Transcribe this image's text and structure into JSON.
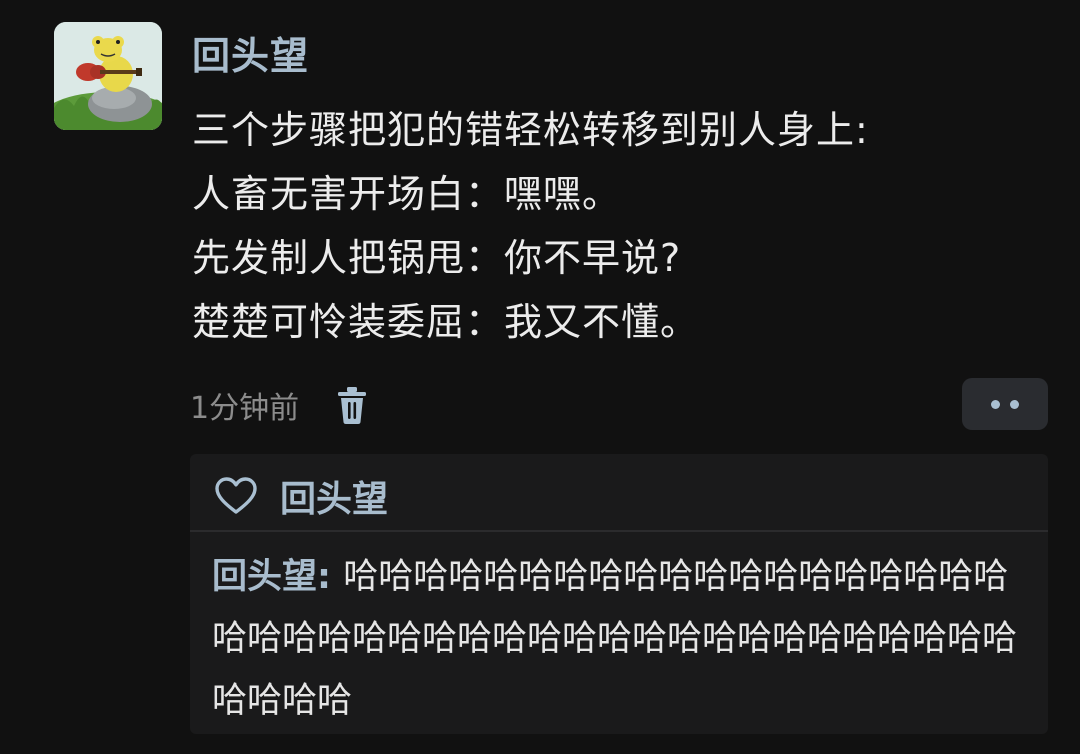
{
  "post": {
    "author": "回头望",
    "lines": [
      "三个步骤把犯的错轻松转移到别人身上:",
      "人畜无害开场白：嘿嘿。",
      "先发制人把锅甩：你不早说?",
      "楚楚可怜装委屈：我又不懂。"
    ],
    "timestamp": "1分钟前",
    "delete_icon": "trash-icon",
    "more_icon": "more-dots-icon"
  },
  "likes": {
    "icon": "heart-icon",
    "names": "回头望"
  },
  "comment": {
    "author": "回头望",
    "separator": ": ",
    "text": "哈哈哈哈哈哈哈哈哈哈哈哈哈哈哈哈哈哈哈哈哈哈哈哈哈哈哈哈哈哈哈哈哈哈哈哈哈哈哈哈哈哈哈哈哈哈"
  },
  "colors": {
    "background": "#111111",
    "name_blue": "#a8bccd",
    "panel": "#1a1a1b",
    "muted_text": "#8c8c8c"
  }
}
